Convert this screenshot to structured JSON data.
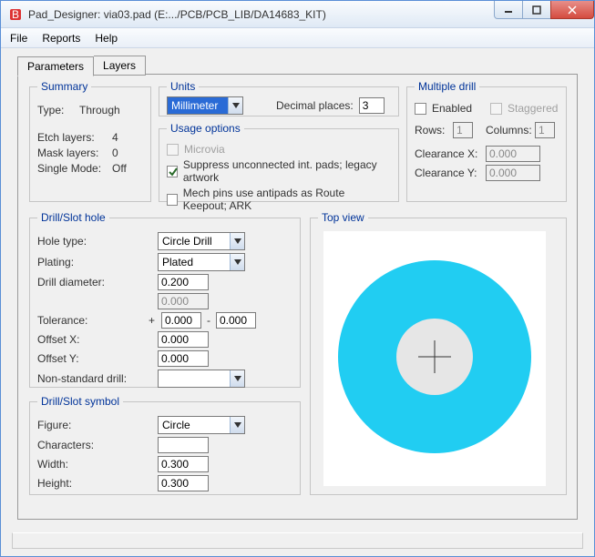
{
  "window": {
    "title": "Pad_Designer: via03.pad (E:.../PCB/PCB_LIB/DA14683_KIT)"
  },
  "menu": {
    "file": "File",
    "reports": "Reports",
    "help": "Help"
  },
  "tabs": {
    "parameters": "Parameters",
    "layers": "Layers"
  },
  "summary": {
    "legend": "Summary",
    "type_label": "Type:",
    "type_value": "Through",
    "etch_label": "Etch layers:",
    "etch_value": "4",
    "mask_label": "Mask layers:",
    "mask_value": "0",
    "single_label": "Single Mode:",
    "single_value": "Off"
  },
  "units": {
    "legend": "Units",
    "value": "Millimeter",
    "decimal_label": "Decimal places:",
    "decimal_value": "3"
  },
  "usage": {
    "legend": "Usage options",
    "microvia": "Microvia",
    "suppress": "Suppress unconnected int. pads; legacy artwork",
    "mech": "Mech pins use antipads as Route Keepout; ARK"
  },
  "multi": {
    "legend": "Multiple drill",
    "enabled": "Enabled",
    "staggered": "Staggered",
    "rows_label": "Rows:",
    "rows_value": "1",
    "cols_label": "Columns:",
    "cols_value": "1",
    "clearx_label": "Clearance X:",
    "clearx_value": "0.000",
    "cleary_label": "Clearance Y:",
    "cleary_value": "0.000"
  },
  "drillhole": {
    "legend": "Drill/Slot hole",
    "holetype_label": "Hole type:",
    "holetype_value": "Circle Drill",
    "plating_label": "Plating:",
    "plating_value": "Plated",
    "diameter_label": "Drill diameter:",
    "diameter_value": "0.200",
    "diameter2_value": "0.000",
    "tolerance_label": "Tolerance:",
    "tol_plus": "+",
    "tol_plus_value": "0.000",
    "tol_sep": "-",
    "tol_minus_value": "0.000",
    "offsetx_label": "Offset X:",
    "offsetx_value": "0.000",
    "offsety_label": "Offset Y:",
    "offsety_value": "0.000",
    "nonstd_label": "Non-standard drill:",
    "nonstd_value": ""
  },
  "drillsym": {
    "legend": "Drill/Slot symbol",
    "figure_label": "Figure:",
    "figure_value": "Circle",
    "chars_label": "Characters:",
    "chars_value": "",
    "width_label": "Width:",
    "width_value": "0.300",
    "height_label": "Height:",
    "height_value": "0.300"
  },
  "topview": {
    "legend": "Top view"
  },
  "colors": {
    "pad": "#21cdf2",
    "hole": "#e6e6e6"
  }
}
